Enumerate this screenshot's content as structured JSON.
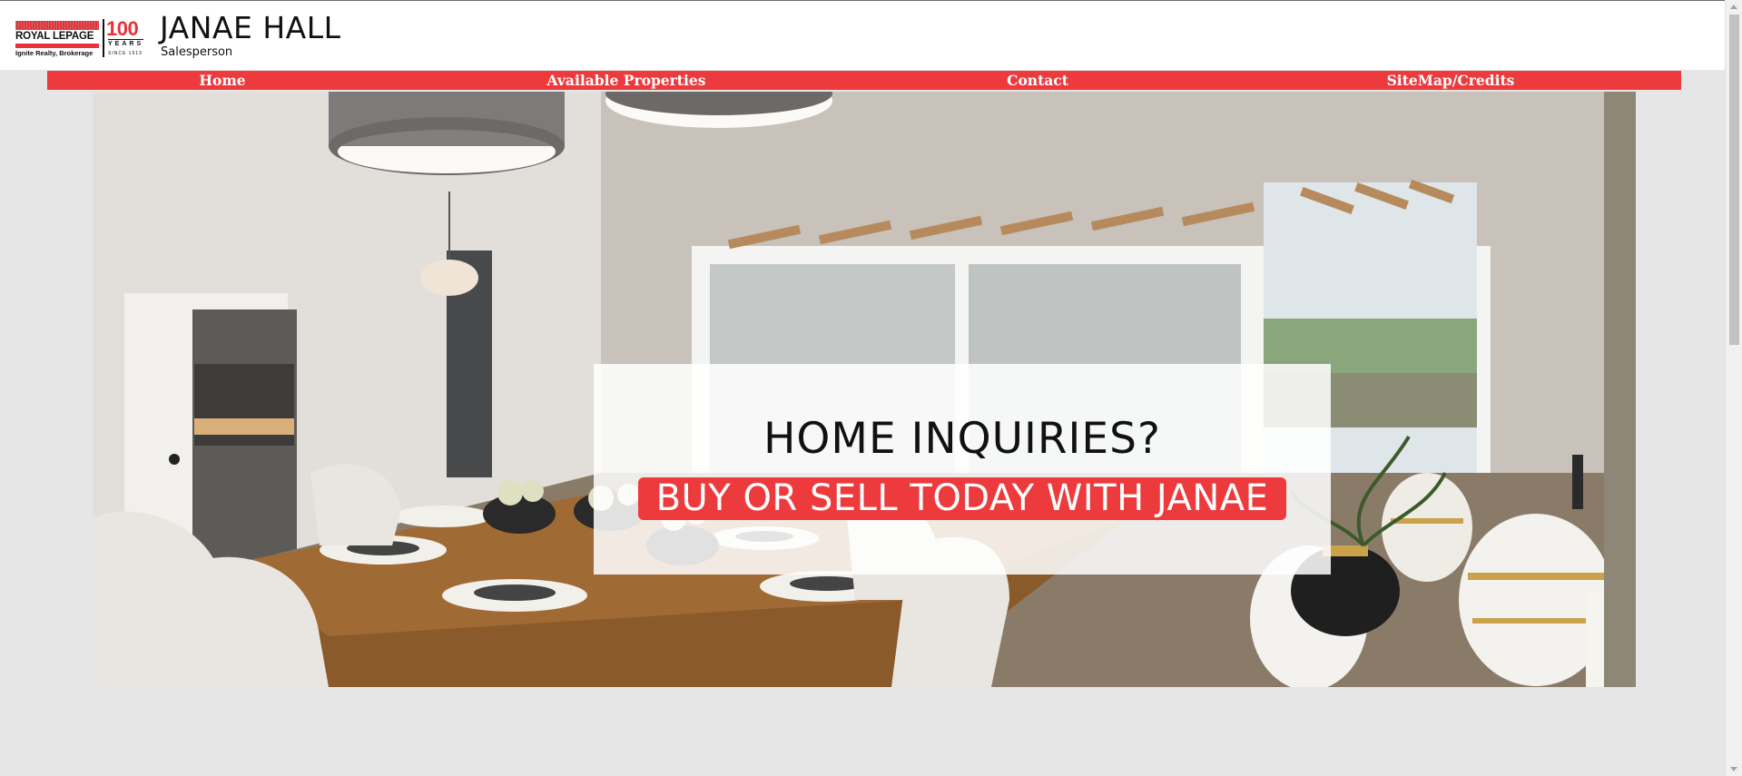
{
  "brand": {
    "logo_name": "ROYAL LEPAGE",
    "logo_sub": "Ignite Realty, Brokerage",
    "anniversary": "100",
    "anniversary_years": "YEARS",
    "anniversary_since": "SINCE 1913",
    "accent_color": "#ed3a3d"
  },
  "agent": {
    "name": "JANAE HALL",
    "title": "Salesperson"
  },
  "nav": {
    "items": [
      {
        "label": "Home"
      },
      {
        "label": "Available Properties"
      },
      {
        "label": "Contact"
      },
      {
        "label": "SiteMap/Credits"
      }
    ]
  },
  "hero": {
    "image": "dining-room-photo",
    "headline": "HOME INQUIRIES?",
    "cta": "BUY OR SELL TODAY WITH JANAE"
  }
}
